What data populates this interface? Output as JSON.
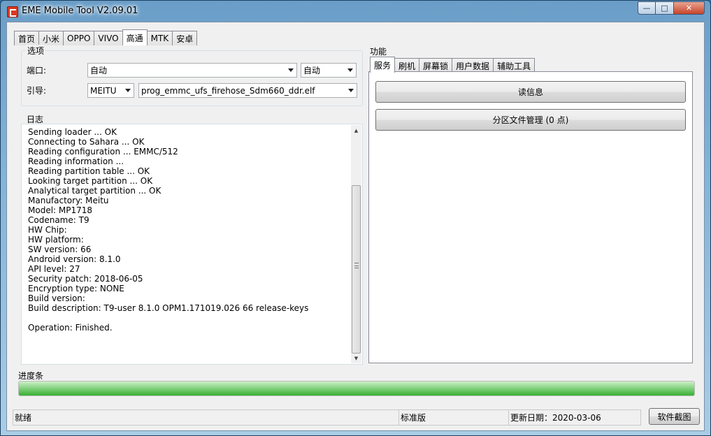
{
  "window": {
    "title": "EME Mobile Tool V2.09.01",
    "controls": {
      "minimize": "—",
      "maximize": "□",
      "close": "✕"
    }
  },
  "main_tabs": [
    "首页",
    "小米",
    "OPPO",
    "VIVO",
    "高通",
    "MTK",
    "安卓"
  ],
  "active_main_tab": "高通",
  "options": {
    "title": "选项",
    "port_label": "端口:",
    "port_value": "自动",
    "port_speed_value": "自动",
    "boot_label": "引导:",
    "brand_value": "MEITU",
    "loader_value": "prog_emmc_ufs_firehose_Sdm660_ddr.elf"
  },
  "log": {
    "title": "日志",
    "lines": [
      "Sending loader ... OK",
      "Connecting to Sahara ... OK",
      "Reading configuration ... EMMC/512",
      "Reading information ...",
      "Reading partition table ... OK",
      "Looking target partition ... OK",
      "Analytical target partition ... OK",
      "Manufactory: Meitu",
      "Model: MP1718",
      "Codename: T9",
      "HW Chip:",
      "HW platform:",
      "SW version: 66",
      "Android version: 8.1.0",
      "API level: 27",
      "Security patch: 2018-06-05",
      "Encryption type: NONE",
      "Build version:",
      "Build description: T9-user 8.1.0 OPM1.171019.026 66 release-keys",
      "",
      "Operation: Finished."
    ]
  },
  "function": {
    "title": "功能",
    "tabs": [
      "服务",
      "刷机",
      "屏幕锁",
      "用户数据",
      "辅助工具"
    ],
    "active_tab": "服务",
    "buttons": {
      "read_info": "读信息",
      "partition_manager": "分区文件管理 (0 点)"
    }
  },
  "progress": {
    "title": "进度条",
    "value_percent": 100,
    "color": "#37b032"
  },
  "status": {
    "state": "就绪",
    "edition": "标准版",
    "update_date": "更新日期：2020-03-06",
    "screenshot_button": "软件截图"
  }
}
